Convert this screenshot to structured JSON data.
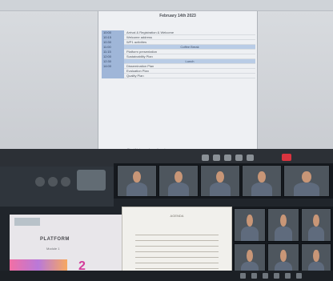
{
  "document": {
    "title": "February 14th 2023",
    "agenda": [
      {
        "time": "10:00",
        "item": "Arrival & Registration & Welcome"
      },
      {
        "time": "10:15",
        "item": "Welcome address"
      },
      {
        "time": "10:30",
        "item": "WP1 activities"
      },
      {
        "time": "11:00",
        "item": "Coffee Break",
        "band": true
      },
      {
        "time": "11:15",
        "item": "Platform presentation"
      },
      {
        "time": "12:00",
        "item": "Sustainability Plan"
      },
      {
        "time": "12:30",
        "item": "Lunch",
        "band": true
      },
      {
        "time": "14:00",
        "item": "Dissemination Plan"
      },
      {
        "time": "",
        "item": "Evaluation Plan"
      },
      {
        "time": "",
        "item": "Quality Plan"
      }
    ],
    "footer": "Final Notes and meeting closure"
  },
  "left_screen": {
    "platform": "PLATFORM",
    "subtitle": "Module 1",
    "number": "2"
  },
  "paper": {
    "heading": "AGENDA"
  }
}
